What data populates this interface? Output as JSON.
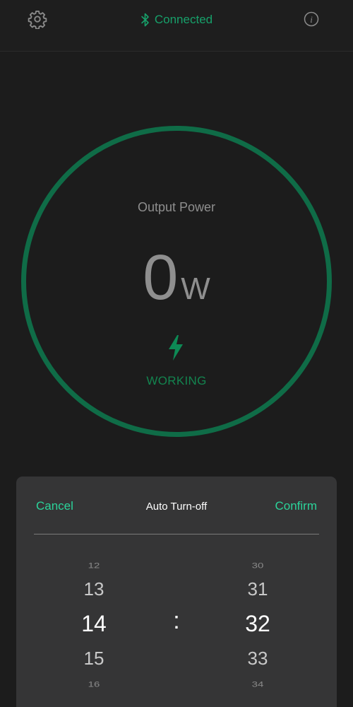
{
  "header": {
    "settings_icon": "gear-icon",
    "status_icon": "bluetooth-icon",
    "status_text": "Connected",
    "info_icon": "info-icon"
  },
  "power": {
    "label": "Output Power",
    "value": "0",
    "unit": "W",
    "status_icon": "lightning-bolt-icon",
    "status_text": "WORKING"
  },
  "timer_sheet": {
    "cancel_label": "Cancel",
    "title": "Auto Turn-off",
    "confirm_label": "Confirm",
    "separator": ":",
    "hours": [
      "12",
      "13",
      "14",
      "15",
      "16"
    ],
    "minutes": [
      "30",
      "31",
      "32",
      "33",
      "34"
    ],
    "selected_hour": "14",
    "selected_minute": "32"
  },
  "colors": {
    "accent": "#2bd39a",
    "ring": "#0f6c47",
    "background": "#1c1c1c",
    "sheet": "#353536"
  }
}
